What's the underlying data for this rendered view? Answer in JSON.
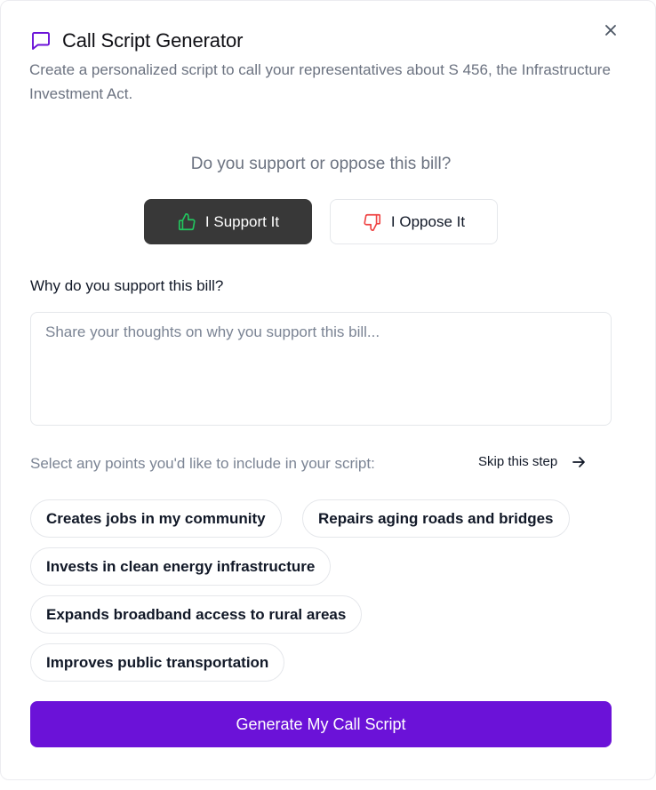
{
  "dialog": {
    "title": "Call Script Generator",
    "subtitle": "Create a personalized script to call your representatives about S 456, the Infrastructure Investment Act.",
    "close_icon": "close-icon",
    "title_icon": "message-square-icon"
  },
  "stance": {
    "question": "Do you support or oppose this bill?",
    "support_label": "I Support It",
    "oppose_label": "I Oppose It",
    "selected": "support",
    "support_icon": "thumbs-up-icon",
    "oppose_icon": "thumbs-down-icon"
  },
  "reason": {
    "label": "Why do you support this bill?",
    "placeholder": "Share your thoughts on why you support this bill...",
    "value": ""
  },
  "points": {
    "label": "Select any points you'd like to include in your script:",
    "skip_label": "Skip this step",
    "items": [
      "Creates jobs in my community",
      "Repairs aging roads and bridges",
      "Invests in clean energy infrastructure",
      "Expands broadband access to rural areas",
      "Improves public transportation"
    ]
  },
  "generate_label": "Generate My Call Script",
  "colors": {
    "accent": "#6b12d8",
    "support_active_bg": "#383838",
    "thumbs_up": "#22c55e",
    "thumbs_down": "#ef4444"
  }
}
